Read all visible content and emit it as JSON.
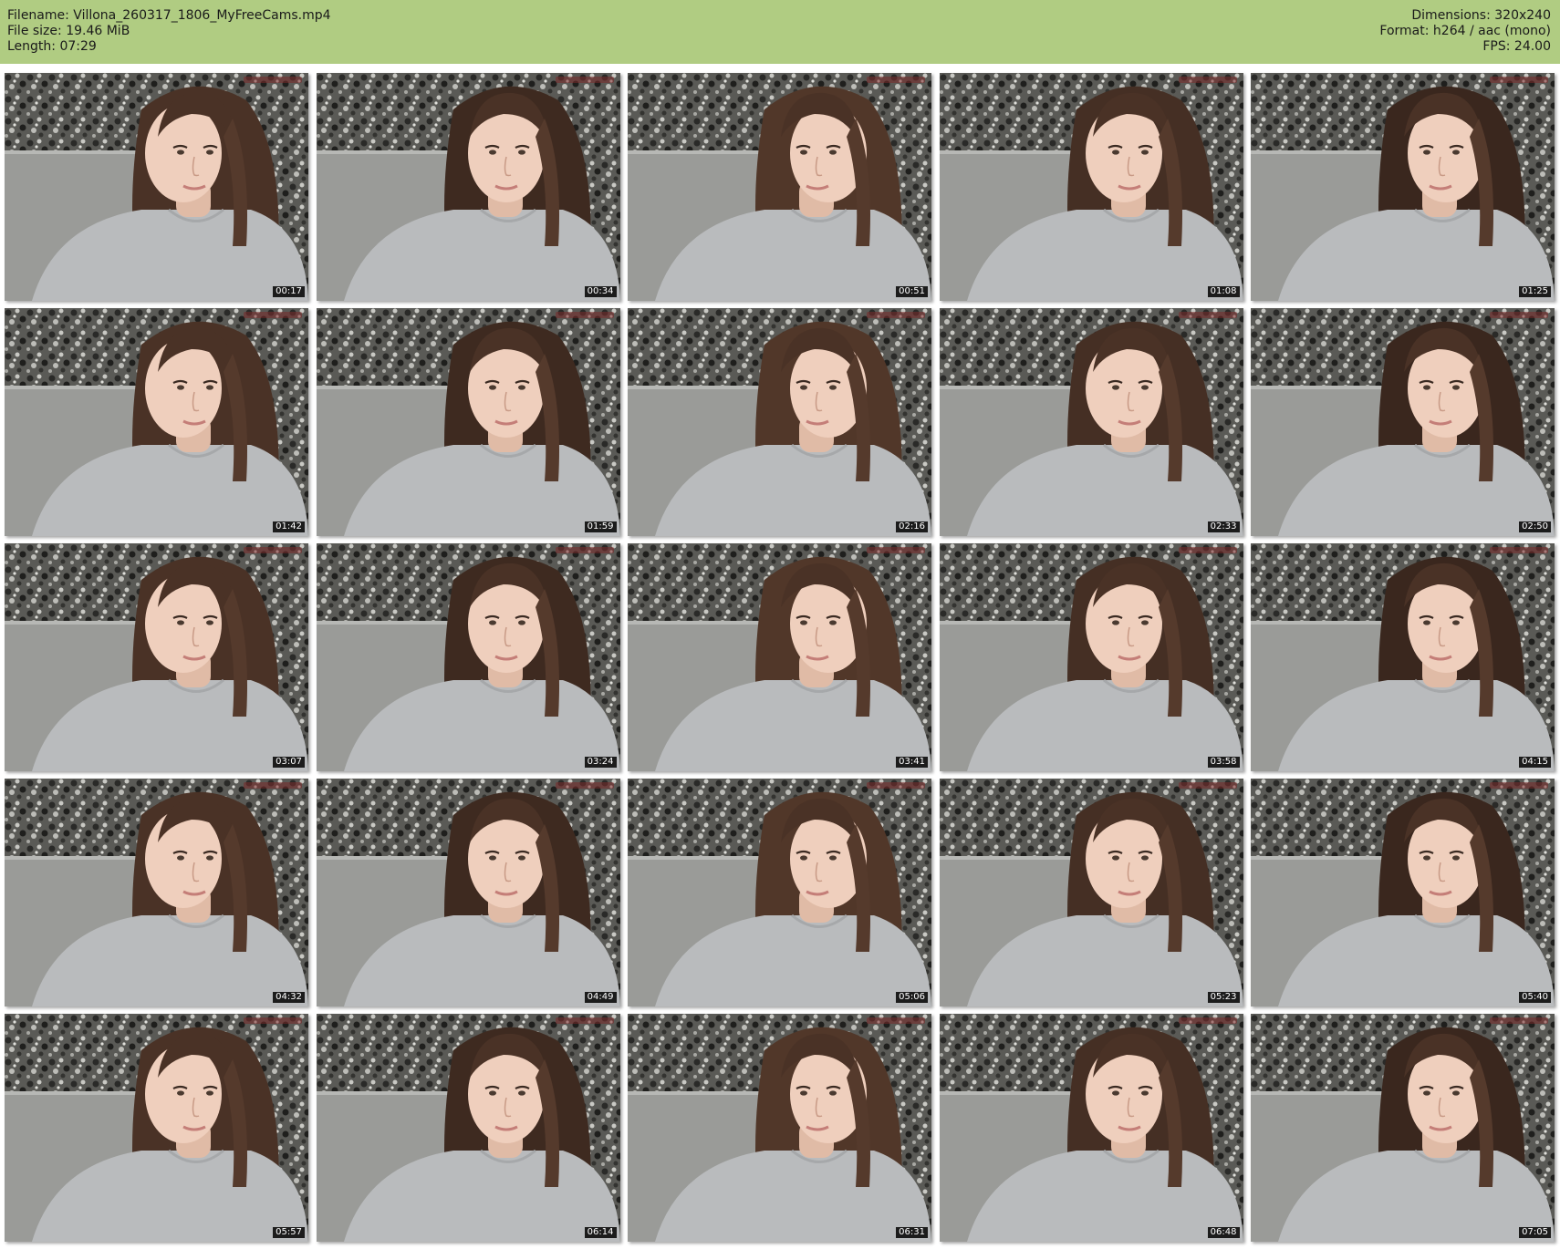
{
  "header": {
    "filename": "Filename: Villona_260317_1806_MyFreeCams.mp4",
    "file_size": "File size: 19.46 MiB",
    "length": "Length: 07:29",
    "dimensions": "Dimensions: 320x240",
    "format": "Format: h264 / aac (mono)",
    "fps": "FPS: 24.00",
    "background_color": "#b0cc82"
  },
  "thumbnails": [
    {
      "time": "00:17"
    },
    {
      "time": "00:34"
    },
    {
      "time": "00:51"
    },
    {
      "time": "01:08"
    },
    {
      "time": "01:25"
    },
    {
      "time": "01:42"
    },
    {
      "time": "01:59"
    },
    {
      "time": "02:16"
    },
    {
      "time": "02:33"
    },
    {
      "time": "02:50"
    },
    {
      "time": "03:07"
    },
    {
      "time": "03:24"
    },
    {
      "time": "03:41"
    },
    {
      "time": "03:58"
    },
    {
      "time": "04:15"
    },
    {
      "time": "04:32"
    },
    {
      "time": "04:49"
    },
    {
      "time": "05:06"
    },
    {
      "time": "05:23"
    },
    {
      "time": "05:40"
    },
    {
      "time": "05:57"
    },
    {
      "time": "06:14"
    },
    {
      "time": "06:31"
    },
    {
      "time": "06:48"
    },
    {
      "time": "07:05"
    }
  ]
}
